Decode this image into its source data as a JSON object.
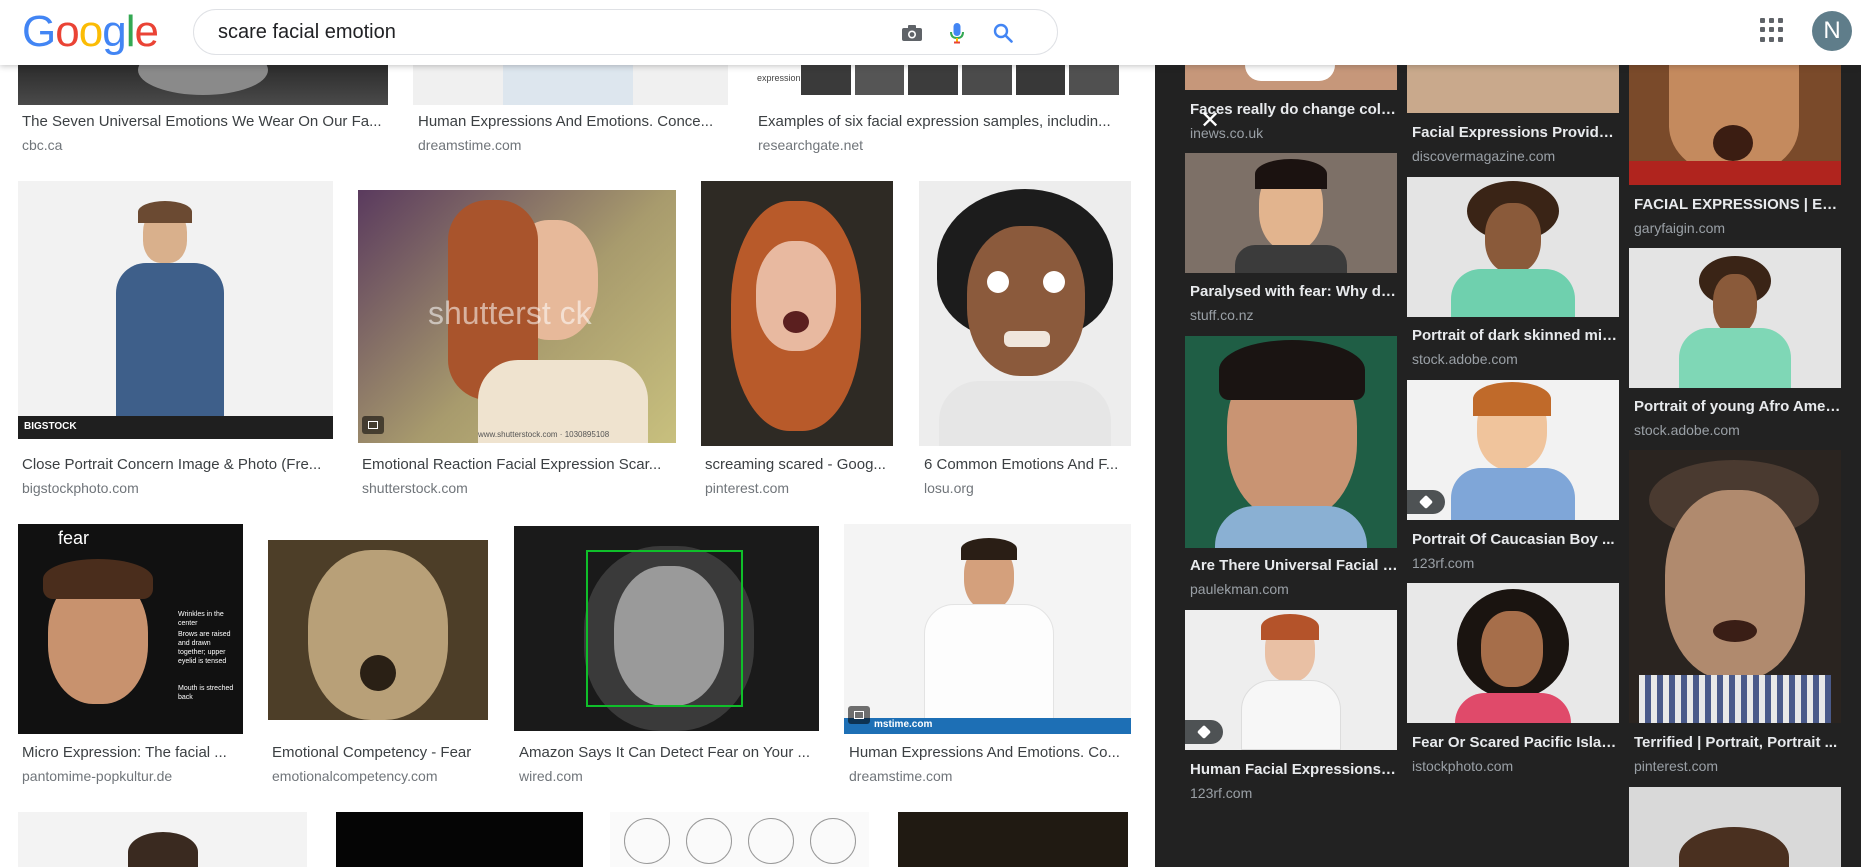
{
  "logo": {
    "letters": [
      "G",
      "o",
      "o",
      "g",
      "l",
      "e"
    ],
    "colors": [
      "#4285F4",
      "#EA4335",
      "#FBBC05",
      "#4285F4",
      "#34A853",
      "#EA4335"
    ]
  },
  "search": {
    "query": "scare facial emotion",
    "icons": [
      "camera-icon",
      "mic-icon",
      "search-icon"
    ]
  },
  "header": {
    "apps_icon": "apps-grid-icon",
    "avatar_letter": "N"
  },
  "results": [
    {
      "title": "The Seven Universal Emotions We Wear On Our Fa...",
      "source": "cbc.ca"
    },
    {
      "title": "Human Expressions And Emotions. Conce...",
      "source": "dreamstime.com"
    },
    {
      "title": "Examples of six facial expression samples, includin...",
      "source": "researchgate.net"
    },
    {
      "title": "Close Portrait Concern Image & Photo (Fre...",
      "source": "bigstockphoto.com"
    },
    {
      "title": "Emotional Reaction Facial Expression Scar...",
      "source": "shutterstock.com"
    },
    {
      "title": "screaming scared - Goog...",
      "source": "pinterest.com"
    },
    {
      "title": "6 Common Emotions And F...",
      "source": "losu.org"
    },
    {
      "title": "Micro Expression: The facial ...",
      "source": "pantomime-popkultur.de"
    },
    {
      "title": "Emotional Competency - Fear",
      "source": "emotionalcompetency.com"
    },
    {
      "title": "Amazon Says It Can Detect Fear on Your ...",
      "source": "wired.com"
    },
    {
      "title": "Human Expressions And Emotions. Co...",
      "source": "dreamstime.com"
    }
  ],
  "image_text": {
    "bigstock": "BIGSTOCK",
    "shutterstock": "shutterst ck",
    "shutterstock_url": "www.shutterstock.com · 1030895108",
    "dreamstime": "mstime.com",
    "fear_label": "fear",
    "fear_notes": [
      "Wrinkles in the center",
      "Brows are raised and drawn together; upper eyelid is tensed",
      "Mouth is streched back"
    ],
    "sample_label": "expression"
  },
  "panel": {
    "close_label": "✕",
    "related": [
      {
        "title": "Faces really do change colo...",
        "source": "inews.co.uk"
      },
      {
        "title": "Paralysed with fear: Why do...",
        "source": "stuff.co.nz"
      },
      {
        "title": "Are There Universal Facial E...",
        "source": "paulekman.com"
      },
      {
        "title": "Human Facial Expressions, ...",
        "source": "123rf.com"
      },
      {
        "title": "Facial Expressions Provide ...",
        "source": "discovermagazine.com"
      },
      {
        "title": "Portrait of dark skinned mix...",
        "source": "stock.adobe.com"
      },
      {
        "title": "Portrait Of Caucasian Boy ...",
        "source": "123rf.com"
      },
      {
        "title": "Fear Or Scared Pacific Islan...",
        "source": "istockphoto.com"
      },
      {
        "title": "FACIAL EXPRESSIONS | Extr...",
        "source": "garyfaigin.com"
      },
      {
        "title": "Portrait of young Afro Amer...",
        "source": "stock.adobe.com"
      },
      {
        "title": "Terrified | Portrait, Portrait ...",
        "source": "pinterest.com"
      }
    ]
  }
}
